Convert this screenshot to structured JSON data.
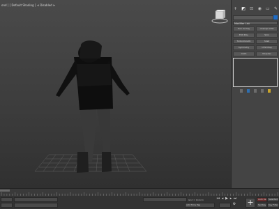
{
  "viewport": {
    "label": "[+] [Perspective ] [Standard ] [Default Shading ] ⊲ Disabled ⊳",
    "label_visible": "ond ] [ Default Shading ]  ⊲ Disabled ⊳"
  },
  "command_panel": {
    "tab_icons": [
      "plus-icon",
      "modify-icon",
      "hierarchy-icon",
      "motion-icon",
      "display-icon",
      "utilities-icon"
    ],
    "object_color": "#1d6cc7",
    "modifier_list": "Modifier List",
    "buttons": [
      "Turn to Poly",
      "Unwrap UVW",
      "Edit Poly",
      "Skin",
      "TurboSmooth",
      "Shell",
      "Symmetry",
      "UVW Map",
      "Cloth",
      "Morpher",
      "Edit Mesh",
      "Chamfer",
      "Relax",
      "FFD",
      "Smooth"
    ]
  },
  "timeline": {
    "slider": "0 / 100"
  },
  "status": {
    "add_time_tag": "Add Time Tag",
    "grid": "Grid = 10.0cm",
    "auto_key": "Auto Key",
    "selected": "Selected",
    "set_key": "Set Key",
    "key_filters": "Key Filters..."
  }
}
